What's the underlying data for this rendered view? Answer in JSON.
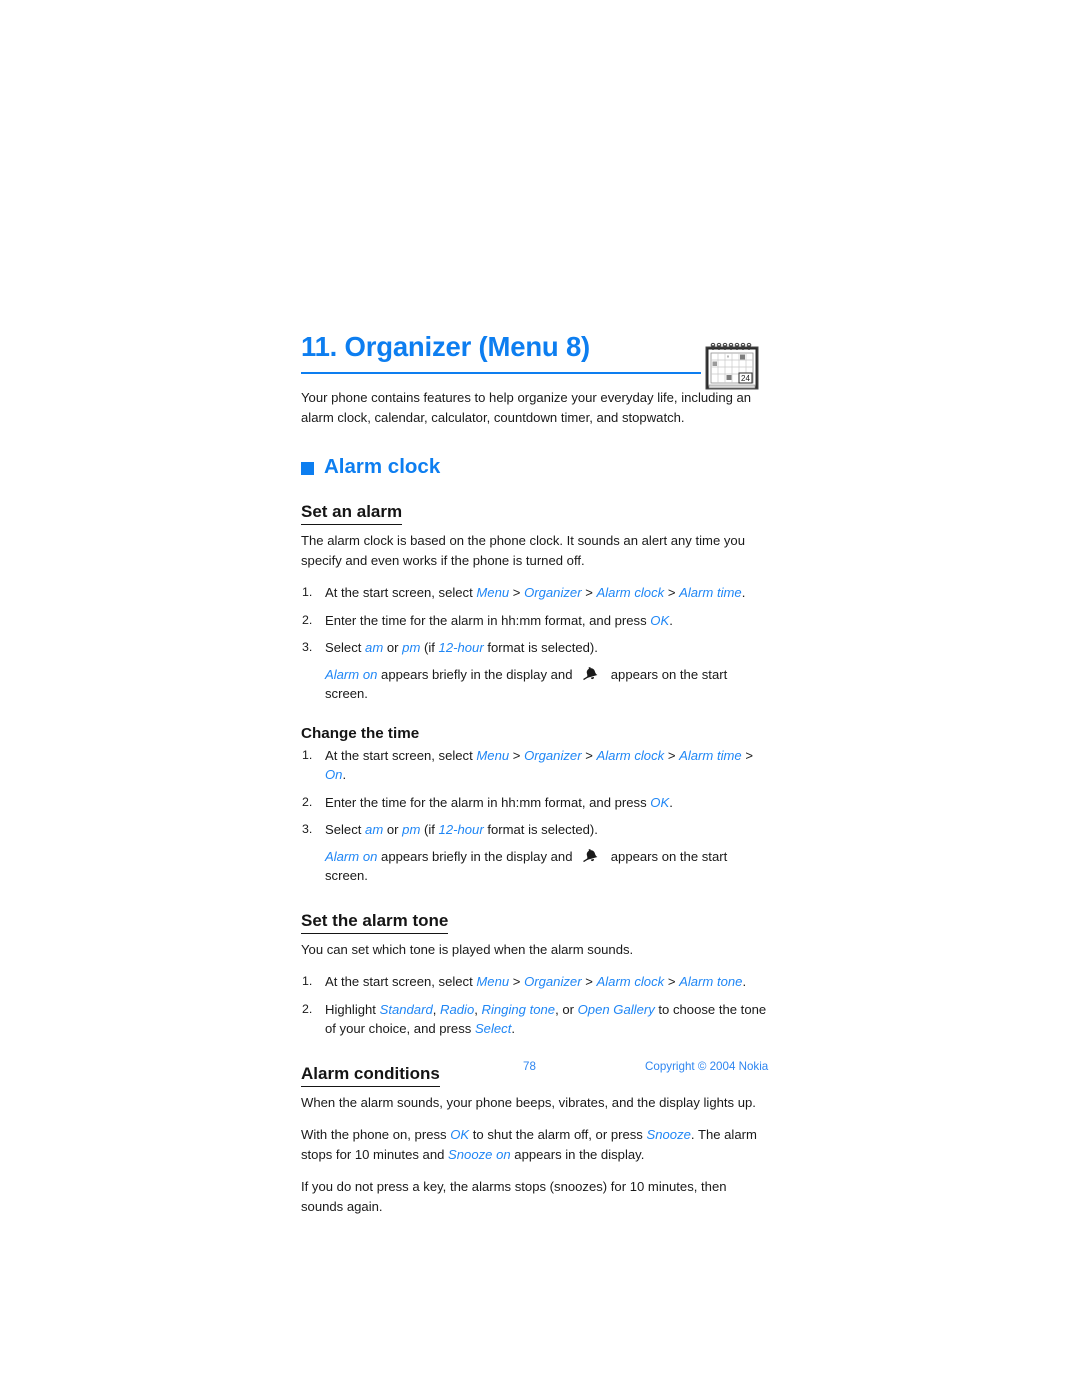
{
  "chapter": {
    "title": "11. Organizer (Menu 8)",
    "icon": "calendar-icon",
    "icon_day": "24",
    "accent_color": "#0d7ef0"
  },
  "intro": "Your phone contains features to help organize your everyday life, including an alarm clock, calendar, calculator, countdown timer, and stopwatch.",
  "section": {
    "title": "Alarm clock",
    "bullet": "square-bullet"
  },
  "set_an_alarm": {
    "heading": "Set an alarm",
    "paragraph": "The alarm clock is based on the phone clock. It sounds an alert any time you specify and even works if the phone is turned off.",
    "steps": [
      {
        "num": "1.",
        "pre": "At the start screen, select ",
        "ui": [
          "Menu",
          "Organizer",
          "Alarm clock",
          "Alarm time"
        ],
        "post": "."
      },
      {
        "num": "2.",
        "pre": "Enter the time for the alarm in hh:mm format, and press ",
        "ui": [
          "OK"
        ],
        "post": "."
      },
      {
        "num": "3.",
        "pre": "Select ",
        "ui": [
          "am",
          "pm",
          "12-hour"
        ],
        "post": " format is selected)."
      }
    ],
    "note": {
      "ui": "Alarm on",
      "mid": " appears briefly in the display and ",
      "icon": "alarm-bell-icon",
      "tail": " appears on the start screen."
    }
  },
  "change_the_time": {
    "heading": "Change the time",
    "steps": [
      {
        "num": "1.",
        "pre": "At the start screen, select ",
        "ui": [
          "Menu",
          "Organizer",
          "Alarm clock",
          "Alarm time",
          "On"
        ],
        "post": "."
      },
      {
        "num": "2.",
        "pre": "Enter the time for the alarm in hh:mm format, and press ",
        "ui": [
          "OK"
        ],
        "post": "."
      },
      {
        "num": "3.",
        "pre": "Select ",
        "ui": [
          "am",
          "pm",
          "12-hour"
        ],
        "post": " format is selected)."
      }
    ],
    "note": {
      "ui": "Alarm on",
      "mid": " appears briefly in the display and ",
      "icon": "alarm-bell-icon",
      "tail": " appears on the start screen."
    }
  },
  "set_the_alarm_tone": {
    "heading": "Set the alarm tone",
    "paragraph": "You can set which tone is played when the alarm sounds.",
    "step1": {
      "num": "1.",
      "pre": "At the start screen, select ",
      "ui": [
        "Menu",
        "Organizer",
        "Alarm clock",
        "Alarm tone"
      ],
      "post": "."
    },
    "step2": {
      "num": "2.",
      "pre": "Highlight ",
      "ui": [
        "Standard",
        "Radio",
        "Ringing tone",
        "Open Gallery",
        "Select"
      ],
      "mid1": ", ",
      "mid2": ", ",
      "mid3": ", or ",
      "mid4": " to choose the tone of your choice, and press ",
      "post": "."
    }
  },
  "alarm_conditions": {
    "heading": "Alarm conditions",
    "p1": "When the alarm sounds, your phone beeps, vibrates, and the display lights up.",
    "p2": {
      "a": "With the phone on, press ",
      "ok": "OK",
      "b": " to shut the alarm off, or press ",
      "snooze": "Snooze",
      "c": ". The alarm stops for 10 minutes and ",
      "snooze_on": "Snooze on",
      "d": " appears in the display."
    },
    "p3": "If you do not press a key, the alarms stops (snoozes) for 10 minutes, then sounds again."
  },
  "footer": {
    "page_number": "78",
    "copyright": "Copyright © 2004 Nokia"
  }
}
